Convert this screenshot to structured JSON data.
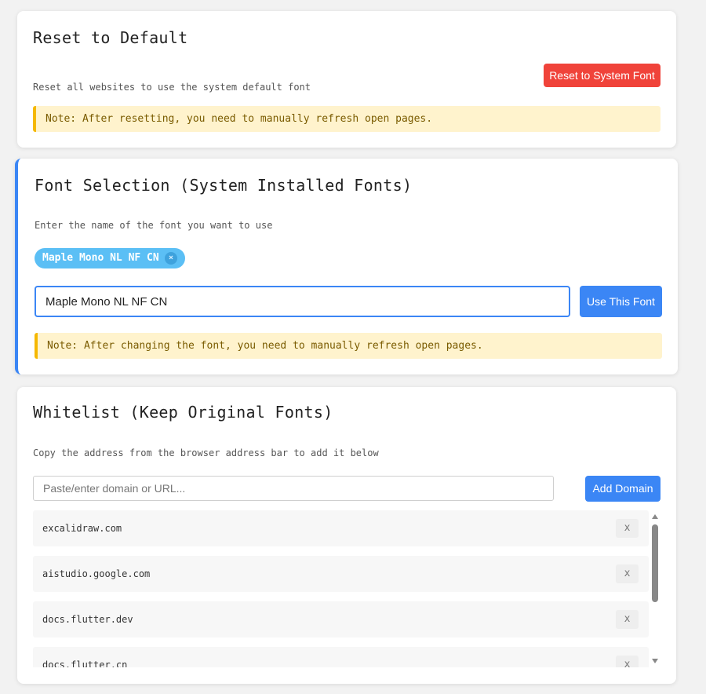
{
  "reset": {
    "title": "Reset to Default",
    "description": "Reset all websites to use the system default font",
    "button_label": "Reset to System Font",
    "note": "Note: After resetting, you need to manually refresh open pages."
  },
  "font_selection": {
    "title": "Font Selection (System Installed Fonts)",
    "description": "Enter the name of the font you want to use",
    "chip_label": "Maple Mono NL NF CN",
    "chip_remove": "×",
    "input_value": "Maple Mono NL NF CN",
    "button_label": "Use This Font",
    "note": "Note: After changing the font, you need to manually refresh open pages."
  },
  "whitelist": {
    "title": "Whitelist (Keep Original Fonts)",
    "description": "Copy the address from the browser address bar to add it below",
    "input_placeholder": "Paste/enter domain or URL...",
    "button_label": "Add Domain",
    "domains": [
      {
        "domain": "excalidraw.com",
        "remove_label": "x"
      },
      {
        "domain": "aistudio.google.com",
        "remove_label": "x"
      },
      {
        "domain": "docs.flutter.dev",
        "remove_label": "x"
      },
      {
        "domain": "docs.flutter.cn",
        "remove_label": "x"
      }
    ]
  },
  "colors": {
    "accent_blue": "#3b86f5",
    "danger_red": "#f0433a",
    "note_bg": "#fff3cd",
    "note_border": "#f5b800",
    "chip_bg": "#5bbff5"
  }
}
